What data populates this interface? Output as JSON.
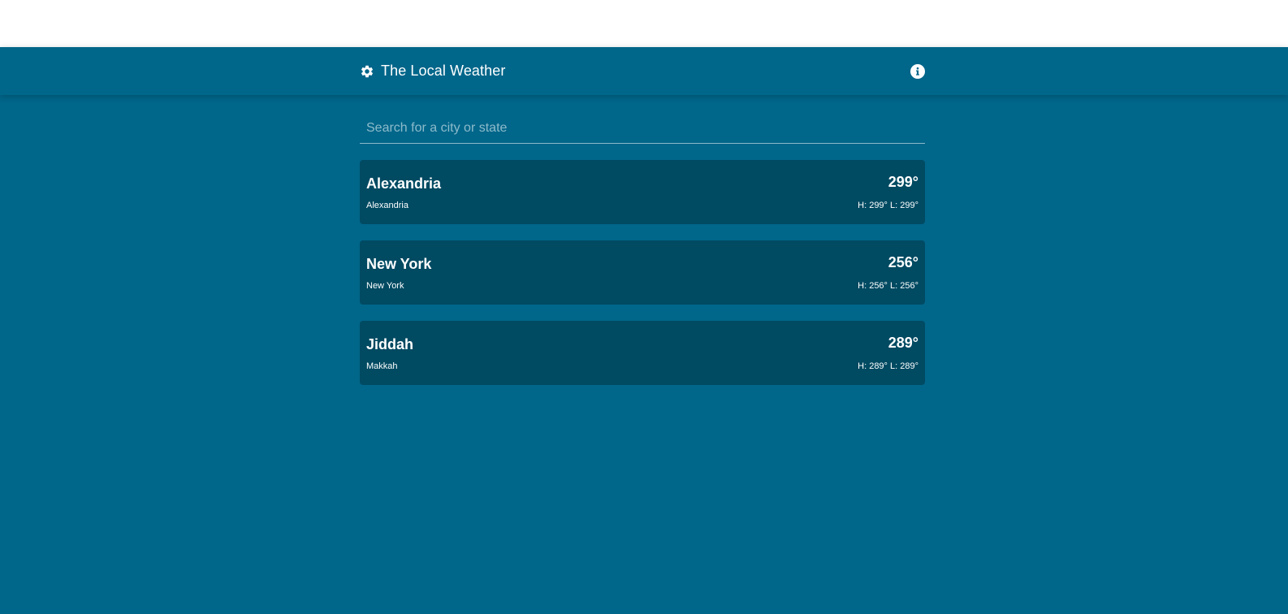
{
  "app": {
    "title": "The Local Weather",
    "settings_icon": "gear-icon",
    "info_icon": "info-circle-icon",
    "background_color": "#00668a",
    "card_color": "#004a62"
  },
  "search": {
    "placeholder": "Search for a city or state",
    "value": ""
  },
  "cities": [
    {
      "name": "Alexandria",
      "state": "Alexandria",
      "temp": "299°",
      "hilo": "H: 299° L: 299°"
    },
    {
      "name": "New York",
      "state": "New York",
      "temp": "256°",
      "hilo": "H: 256° L: 256°"
    },
    {
      "name": "Jiddah",
      "state": "Makkah",
      "temp": "289°",
      "hilo": "H: 289° L: 289°"
    }
  ]
}
